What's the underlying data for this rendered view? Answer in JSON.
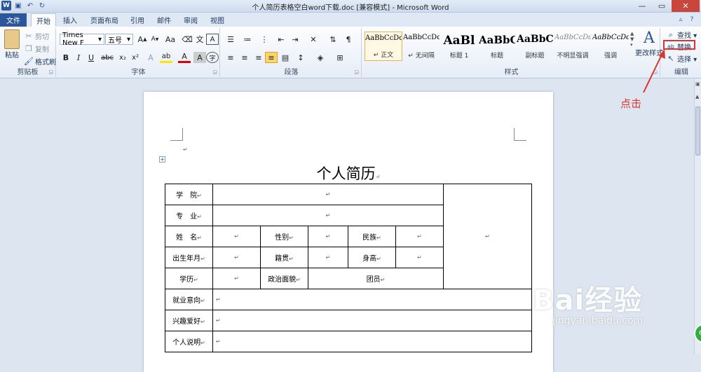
{
  "window": {
    "title": "个人简历表格空白word下载.doc [兼容模式] - Microsoft Word"
  },
  "qat": {
    "word_icon": "W",
    "save_icon": "save-icon",
    "undo_icon": "undo-icon",
    "redo_icon": "redo-icon"
  },
  "tabs": [
    "文件",
    "开始",
    "插入",
    "页面布局",
    "引用",
    "邮件",
    "审阅",
    "视图"
  ],
  "clipboard": {
    "paste": "粘贴",
    "cut": "剪切",
    "copy": "复制",
    "format_painter": "格式刷",
    "label": "剪贴板"
  },
  "font": {
    "name": "Times New F",
    "size": "五号",
    "label": "字体"
  },
  "paragraph": {
    "label": "段落"
  },
  "styles": {
    "label": "样式",
    "items": [
      {
        "sample": "AaBbCcDd",
        "name": "↵ 正文"
      },
      {
        "sample": "AaBbCcDd",
        "name": "↵ 无间隔"
      },
      {
        "sample": "AaBl",
        "name": "标题 1"
      },
      {
        "sample": "AaBbC",
        "name": "标题"
      },
      {
        "sample": "AaBbC",
        "name": "副标题"
      },
      {
        "sample": "AaBbCcDd",
        "name": "不明显强调"
      },
      {
        "sample": "AaBbCcDd",
        "name": "强调"
      }
    ],
    "change_styles": "更改样式"
  },
  "editing": {
    "find": "查找 ▾",
    "replace": "替换",
    "select": "选择 ▾",
    "label": "编辑"
  },
  "document": {
    "title": "个人简历",
    "table": {
      "school": "学　院",
      "major": "专　业",
      "name": "姓　名",
      "gender": "性别",
      "ethnicity": "民族",
      "birth": "出生年月",
      "native_place": "籍贯",
      "height": "身高",
      "education": "学历",
      "political": "政治面貌",
      "league": "团员",
      "job_intent": "就业意向",
      "hobbies": "兴趣爱好",
      "personal": "个人说明"
    }
  },
  "annotation": {
    "text": "点击"
  },
  "watermark": {
    "logo": "Bai经验",
    "url": "jingyan.baidu.com"
  },
  "badge": {
    "text": "6"
  }
}
